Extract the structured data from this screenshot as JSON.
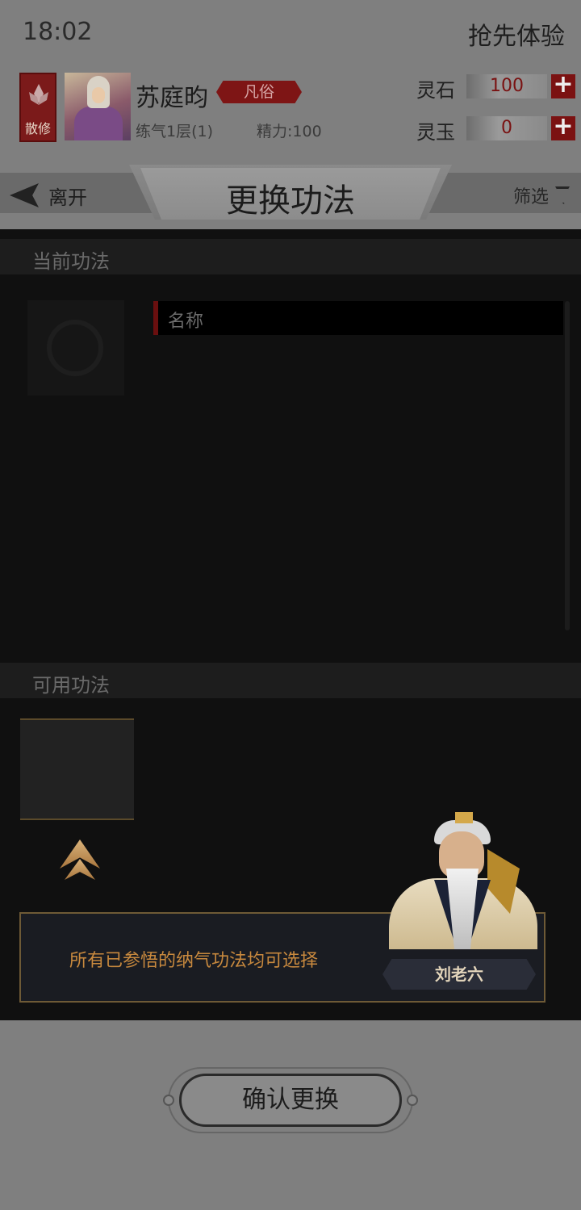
{
  "status_bar": {
    "time": "18:02",
    "early_access": "抢先体验"
  },
  "player": {
    "sect_label": "散修",
    "name": "苏庭昀",
    "rank": "凡俗",
    "level": "练气1层(1)",
    "energy": "精力:100"
  },
  "resources": [
    {
      "label": "灵石",
      "value": "100"
    },
    {
      "label": "灵玉",
      "value": "0"
    }
  ],
  "nav": {
    "back_label": "离开",
    "title": "更换功法",
    "filter_label": "筛选"
  },
  "current_section": {
    "header": "当前功法",
    "name_placeholder": "名称"
  },
  "available_section": {
    "header": "可用功法"
  },
  "npc": {
    "dialog": "所有已参悟的纳气功法均可选择",
    "name": "刘老六"
  },
  "confirm_button": "确认更换",
  "colors": {
    "accent_red": "#7b1212",
    "gold": "#c8893e",
    "panel_bg": "#101010"
  }
}
